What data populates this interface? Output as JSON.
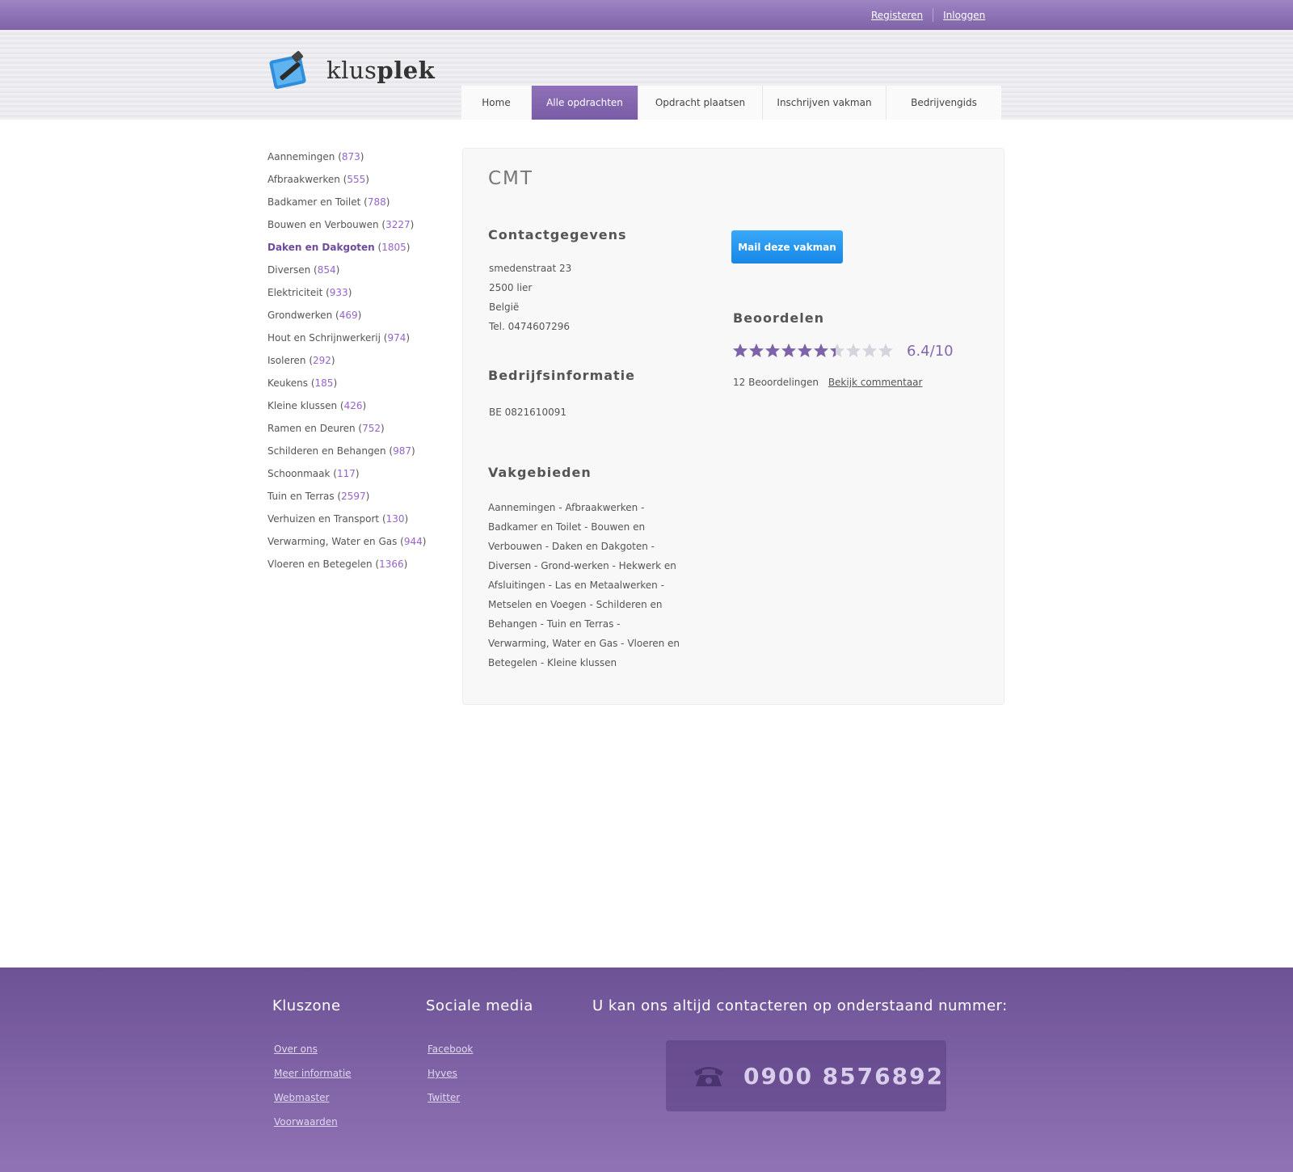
{
  "top_links": {
    "register": "Registeren",
    "login": "Inloggen"
  },
  "logo": {
    "light": "klus",
    "bold": "plek"
  },
  "nav": [
    {
      "label": "Home",
      "active": false
    },
    {
      "label": "Alle opdrachten",
      "active": true
    },
    {
      "label": "Opdracht plaatsen",
      "active": false
    },
    {
      "label": "Inschrijven vakman",
      "active": false
    },
    {
      "label": "Bedrijvengids",
      "active": false
    }
  ],
  "categories": [
    {
      "label": "Aannemingen",
      "count": "873"
    },
    {
      "label": "Afbraakwerken",
      "count": "555"
    },
    {
      "label": "Badkamer en Toilet",
      "count": "788"
    },
    {
      "label": "Bouwen en Verbouwen",
      "count": "3227"
    },
    {
      "label": "Daken en Dakgoten",
      "count": "1805"
    },
    {
      "label": "Diversen",
      "count": "854"
    },
    {
      "label": "Elektriciteit",
      "count": "933"
    },
    {
      "label": "Grondwerken",
      "count": "469"
    },
    {
      "label": "Hout en Schrijnwerkerij",
      "count": "974"
    },
    {
      "label": "Isoleren",
      "count": "292"
    },
    {
      "label": "Keukens",
      "count": "185"
    },
    {
      "label": "Kleine klussen",
      "count": "426"
    },
    {
      "label": "Ramen en Deuren",
      "count": "752"
    },
    {
      "label": "Schilderen en Behangen",
      "count": "987"
    },
    {
      "label": "Schoonmaak",
      "count": "117"
    },
    {
      "label": "Tuin en Terras",
      "count": "2597"
    },
    {
      "label": "Verhuizen en Transport",
      "count": "130"
    },
    {
      "label": "Verwarming, Water en Gas",
      "count": "944"
    },
    {
      "label": "Vloeren en Betegelen",
      "count": "1366"
    }
  ],
  "active_category": "Daken en Dakgoten",
  "company": {
    "name": "CMT",
    "contact_heading": "Contactgegevens",
    "address_lines": [
      "smedenstraat 23",
      "2500 lier",
      "België",
      "Tel. 0474607296"
    ],
    "info_heading": "Bedrijfsinformatie",
    "vat": "BE 0821610091",
    "fields_heading": "Vakgebieden",
    "fields_text": "Aannemingen - Afbraakwerken - Badkamer en Toilet - Bouwen en Verbouwen - Daken en Dakgoten - Diversen - Grond-werken - Hekwerk en Afsluitingen - Las en Metaalwerken - Metselen en Voegen - Schilderen en Behangen - Tuin en Terras - Verwarming, Water en Gas - Vloeren en Betegelen - Kleine klussen"
  },
  "mail_button": "Mail deze vakman",
  "rating": {
    "heading": "Beoordelen",
    "score": 6.4,
    "max": 10,
    "score_text": "6.4/10",
    "reviews_text": "12 Beoordelingen",
    "comments_link": "Bekijk commentaar",
    "star_filled": "#7d63aa",
    "star_empty": "#d4d4dc"
  },
  "footer": {
    "col1": {
      "heading": "Kluszone",
      "links": [
        "Over ons",
        "Meer informatie",
        "Webmaster",
        "Voorwaarden"
      ]
    },
    "col2": {
      "heading": "Sociale media",
      "links": [
        "Facebook",
        "Hyves",
        "Twitter"
      ]
    },
    "contact_heading": "U kan ons altijd contacteren op onderstaand nummer:",
    "phone": "0900 8576892"
  }
}
